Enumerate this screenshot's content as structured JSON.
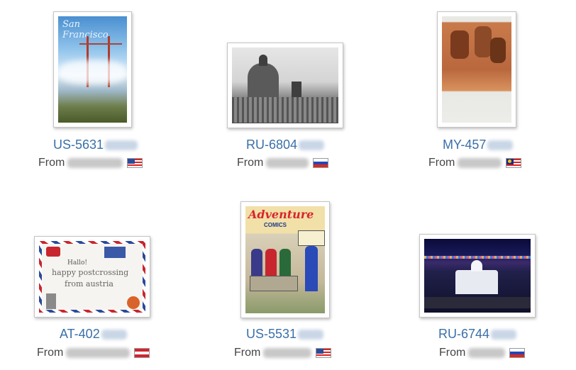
{
  "postcards": [
    {
      "code": "US-5631",
      "from_label": "From",
      "country_flag": "flag-us-icon"
    },
    {
      "code": "RU-6804",
      "from_label": "From",
      "country_flag": "flag-ru-icon"
    },
    {
      "code": "MY-457",
      "from_label": "From",
      "country_flag": "flag-my-icon"
    },
    {
      "code": "AT-402",
      "from_label": "From",
      "country_flag": "flag-at-icon"
    },
    {
      "code": "US-5531",
      "from_label": "From",
      "country_flag": "flag-us-icon"
    },
    {
      "code": "RU-6744",
      "from_label": "From",
      "country_flag": "flag-ru-icon"
    }
  ],
  "card1": {
    "title_text": "San Francisco"
  },
  "card5": {
    "title_text": "Adventure",
    "subtitle_text": "COMICS"
  },
  "card4": {
    "lines": [
      "Hallo!",
      "happy postcrossing",
      "from austria"
    ]
  },
  "colors": {
    "link": "#3a6fa8",
    "text": "#444444",
    "frame_border": "#c4c4c4"
  }
}
